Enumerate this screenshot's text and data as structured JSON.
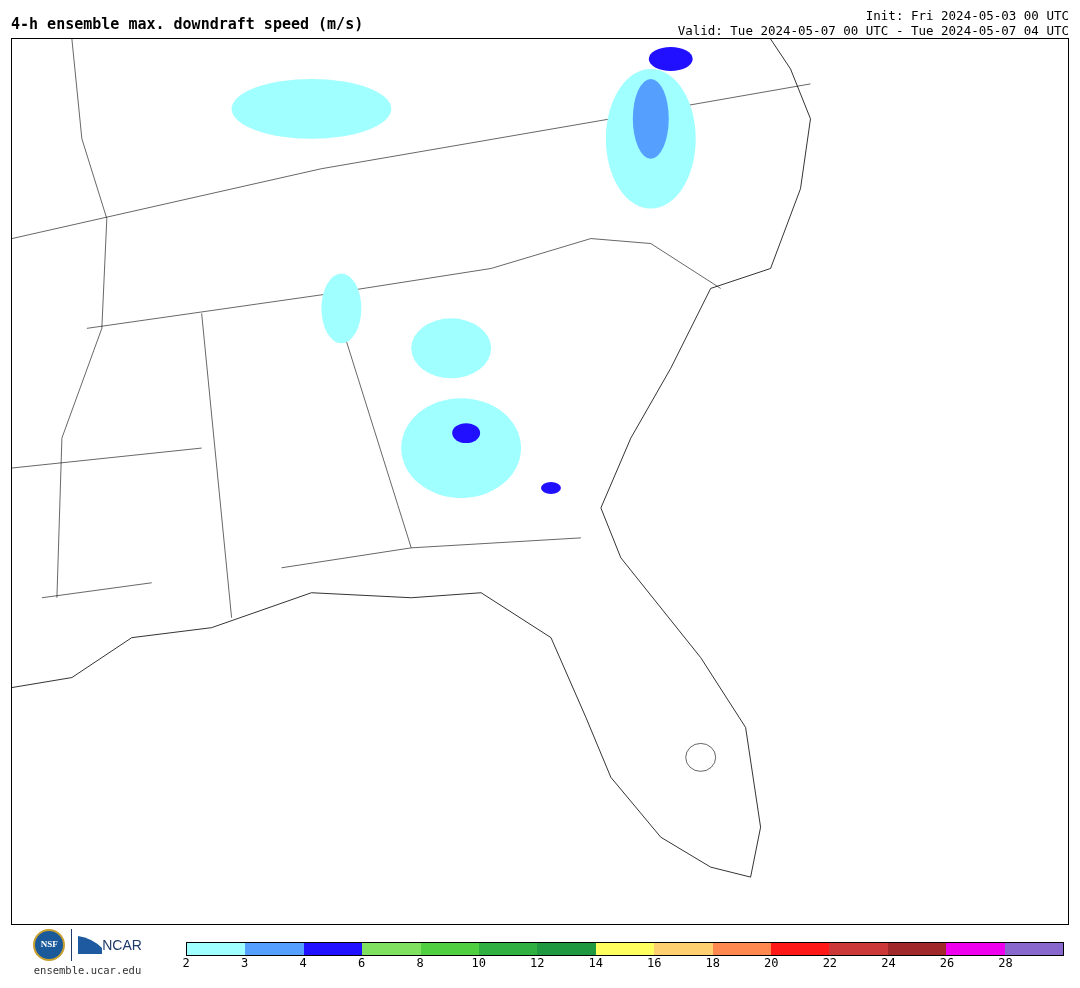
{
  "title": "4-h ensemble max. downdraft speed (m/s)",
  "init": "Init: Fri 2024-05-03 00 UTC",
  "valid": "Valid: Tue 2024-05-07 00 UTC - Tue 2024-05-07 04 UTC",
  "logos": {
    "nsf": "NSF",
    "ncar": "NCAR",
    "url": "ensemble.ucar.edu"
  },
  "colorbar": {
    "segments": [
      {
        "color": "#a0ffff"
      },
      {
        "color": "#55a0ff"
      },
      {
        "color": "#2010ff"
      },
      {
        "color": "#80e060"
      },
      {
        "color": "#50d040"
      },
      {
        "color": "#30b040"
      },
      {
        "color": "#209840"
      },
      {
        "color": "#ffff60"
      },
      {
        "color": "#ffd070"
      },
      {
        "color": "#ff8850"
      },
      {
        "color": "#ff1818"
      },
      {
        "color": "#cc3838"
      },
      {
        "color": "#a02828"
      },
      {
        "color": "#ee00ee"
      },
      {
        "color": "#8868cc"
      }
    ],
    "ticks": [
      "2",
      "3",
      "4",
      "6",
      "8",
      "10",
      "12",
      "14",
      "16",
      "18",
      "20",
      "22",
      "24",
      "26",
      "28"
    ]
  }
}
